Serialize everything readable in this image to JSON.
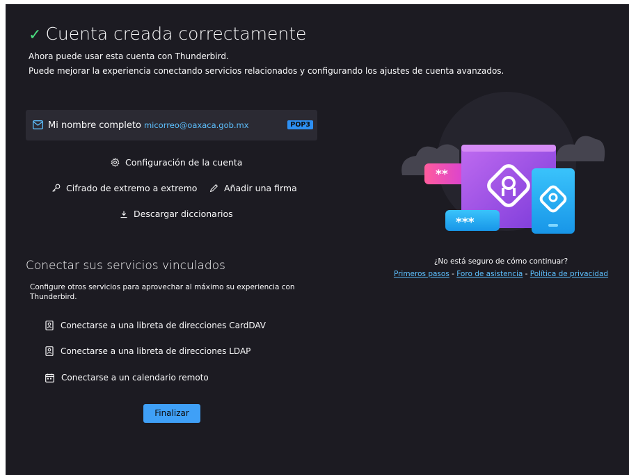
{
  "header": {
    "title": "Cuenta creada correctamente",
    "subtitle_1": "Ahora puede usar esta cuenta con Thunderbird.",
    "subtitle_2": "Puede mejorar la experiencia conectando servicios relacionados y configurando los ajustes de cuenta avanzados."
  },
  "account": {
    "name": "Mi nombre completo",
    "email": "micorreo@oaxaca.gob.mx",
    "type": "POP3"
  },
  "actions": {
    "settings": "Configuración de la cuenta",
    "e2ee": "Cifrado de extremo a extremo",
    "signature": "Añadir una firma",
    "dictionaries": "Descargar diccionarios"
  },
  "connect": {
    "title": "Conectar sus servicios vinculados",
    "description": "Configure otros servicios para aprovechar al máximo su experiencia con Thunderbird.",
    "services": [
      "Conectarse a una libreta de direcciones CardDAV",
      "Conectarse a una libreta de direcciones LDAP",
      "Conectarse a un calendario remoto"
    ]
  },
  "finish_label": "Finalizar",
  "help": {
    "question": "¿No está seguro de cómo continuar?",
    "link_getting_started": "Primeros pasos",
    "link_support": "Foro de asistencia",
    "link_privacy": "Política de privacidad",
    "separator": " - "
  },
  "illustration": {
    "password_short": "**",
    "password_long": "***"
  },
  "colors": {
    "background": "#1c1b22",
    "panel": "#2b2a33",
    "accent": "#3fa0f7",
    "link": "#5dc0ff",
    "success": "#4ade80"
  }
}
